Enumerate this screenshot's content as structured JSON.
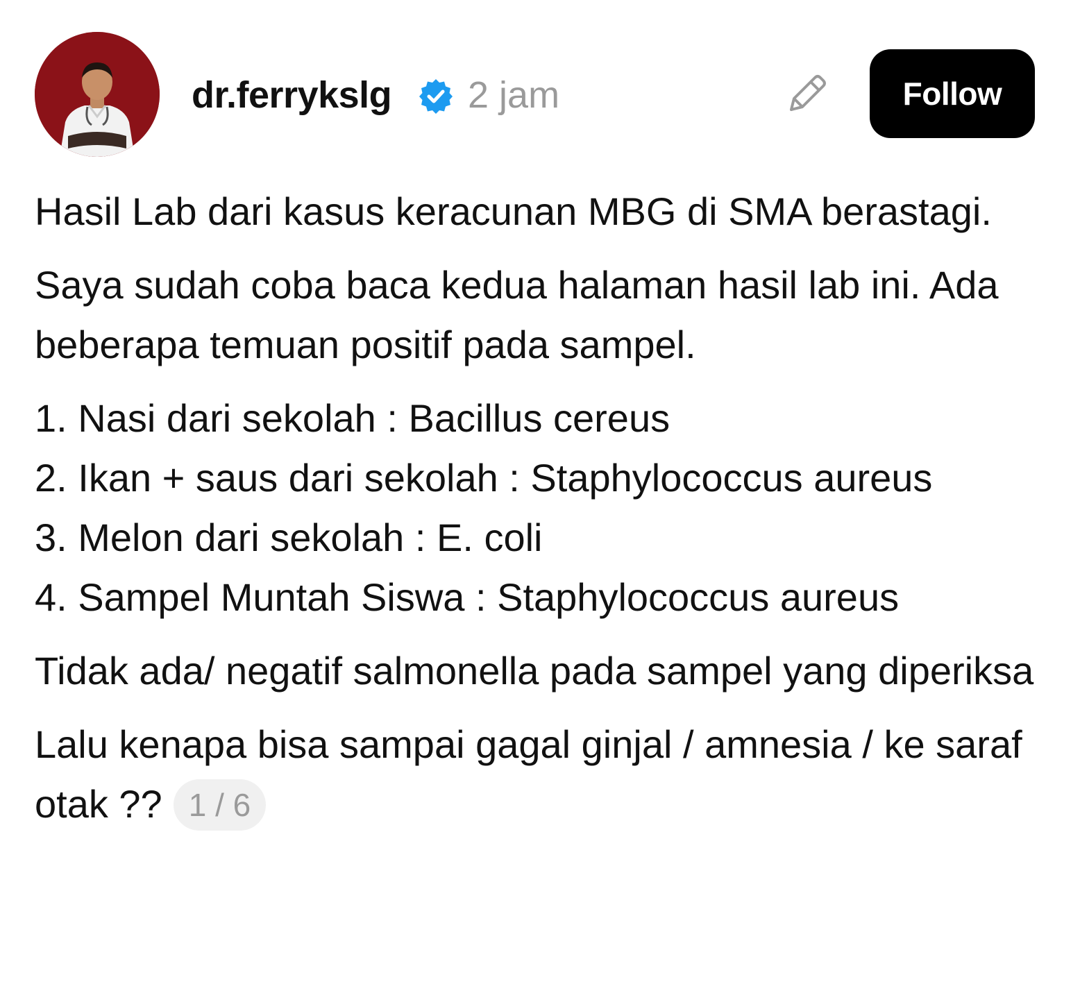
{
  "post": {
    "username": "dr.ferrykslg",
    "time": "2 jam",
    "follow_label": "Follow",
    "paragraphs": [
      "Hasil Lab dari kasus keracunan MBG di SMA berastagi.",
      "Saya sudah coba baca kedua halaman hasil lab ini. Ada beberapa temuan positif pada sampel."
    ],
    "list": [
      "1. Nasi dari sekolah : Bacillus cereus",
      "2. Ikan + saus dari sekolah : Staphylococcus aureus",
      "3. Melon dari sekolah : E. coli",
      "4. Sampel Muntah Siswa : Staphylococcus aureus"
    ],
    "paragraph_after_list": "Tidak ada/ negatif salmonella pada sampel yang diperiksa",
    "last_paragraph": "Lalu kenapa bisa sampai gagal ginjal / amnesia / ke saraf otak ??",
    "page_counter": "1 / 6"
  },
  "colors": {
    "avatar_bg": "#8b1218",
    "verified_blue": "#1d9bf0",
    "follow_bg": "#000000",
    "muted_text": "#9a9a9a"
  },
  "icons": {
    "verified": "verified-badge-icon",
    "edit": "pencil-icon"
  }
}
